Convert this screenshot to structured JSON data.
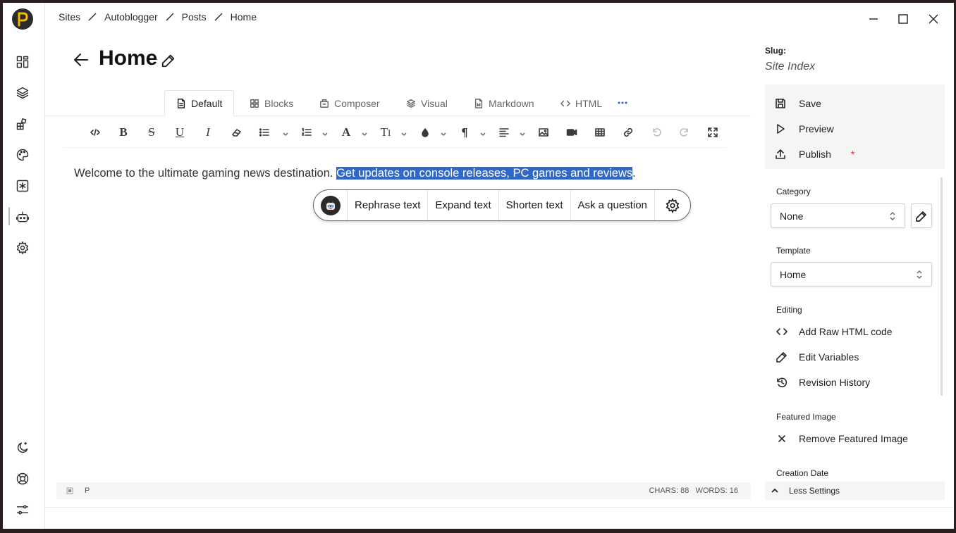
{
  "breadcrumb": [
    "Sites",
    "Autoblogger",
    "Posts",
    "Home"
  ],
  "page": {
    "title": "Home"
  },
  "tabs": [
    {
      "label": "Default",
      "icon": "document-icon"
    },
    {
      "label": "Blocks",
      "icon": "grid-icon"
    },
    {
      "label": "Composer",
      "icon": "composer-icon"
    },
    {
      "label": "Visual",
      "icon": "layers-icon"
    },
    {
      "label": "Markdown",
      "icon": "markdown-file-icon"
    },
    {
      "label": "HTML",
      "icon": "code-icon"
    }
  ],
  "editor": {
    "text_before": "Welcome to the ultimate gaming news destination. ",
    "text_selected": "Get updates on console releases, PC games and reviews",
    "text_after": "."
  },
  "ai_popup": {
    "actions": [
      "Rephrase text",
      "Expand text",
      "Shorten text",
      "Ask a question"
    ]
  },
  "statusbar": {
    "element": "P",
    "counts": "CHARS: 88   WORDS: 16"
  },
  "sidebar": {
    "slug_label": "Slug:",
    "slug_value": "Site Index",
    "actions": {
      "save": "Save",
      "preview": "Preview",
      "publish": "Publish",
      "publish_marker": "*"
    },
    "category_label": "Category",
    "category_value": "None",
    "template_label": "Template",
    "template_value": "Home",
    "editing_label": "Editing",
    "editing_items": [
      "Add Raw HTML code",
      "Edit Variables",
      "Revision History"
    ],
    "featured_label": "Featured Image",
    "featured_remove": "Remove Featured Image",
    "creation_label": "Creation Date",
    "less_settings": "Less Settings"
  },
  "colors": {
    "selection": "#2f68c8",
    "required": "#e03030",
    "logo_accent": "#f5b800"
  }
}
